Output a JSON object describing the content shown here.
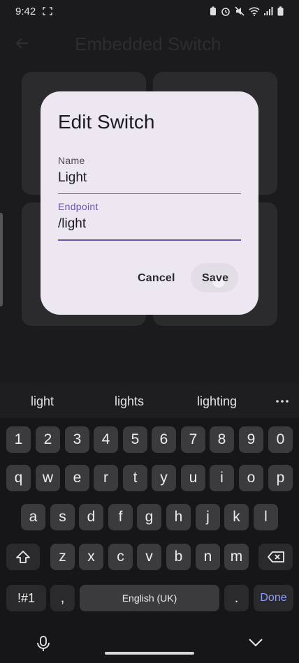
{
  "status": {
    "time": "9:42"
  },
  "app": {
    "title": "Embedded Switch"
  },
  "dialog": {
    "title": "Edit Switch",
    "name_label": "Name",
    "name_value": "Light",
    "endpoint_label": "Endpoint",
    "endpoint_value": "/light",
    "cancel_label": "Cancel",
    "save_label": "Save"
  },
  "keyboard": {
    "suggestions": [
      "light",
      "lights",
      "lighting"
    ],
    "row_numbers": [
      "1",
      "2",
      "3",
      "4",
      "5",
      "6",
      "7",
      "8",
      "9",
      "0"
    ],
    "row_top": [
      "q",
      "w",
      "e",
      "r",
      "t",
      "y",
      "u",
      "i",
      "o",
      "p"
    ],
    "row_mid": [
      "a",
      "s",
      "d",
      "f",
      "g",
      "h",
      "j",
      "k",
      "l"
    ],
    "row_bottom": [
      "z",
      "x",
      "c",
      "v",
      "b",
      "n",
      "m"
    ],
    "symbols_label": "!#1",
    "comma_label": ",",
    "space_label": "English (UK)",
    "period_label": ".",
    "done_label": "Done"
  },
  "colors": {
    "accent": "#6b56a6",
    "dialog_bg": "#ede7f1",
    "done": "#8a9cf5"
  }
}
